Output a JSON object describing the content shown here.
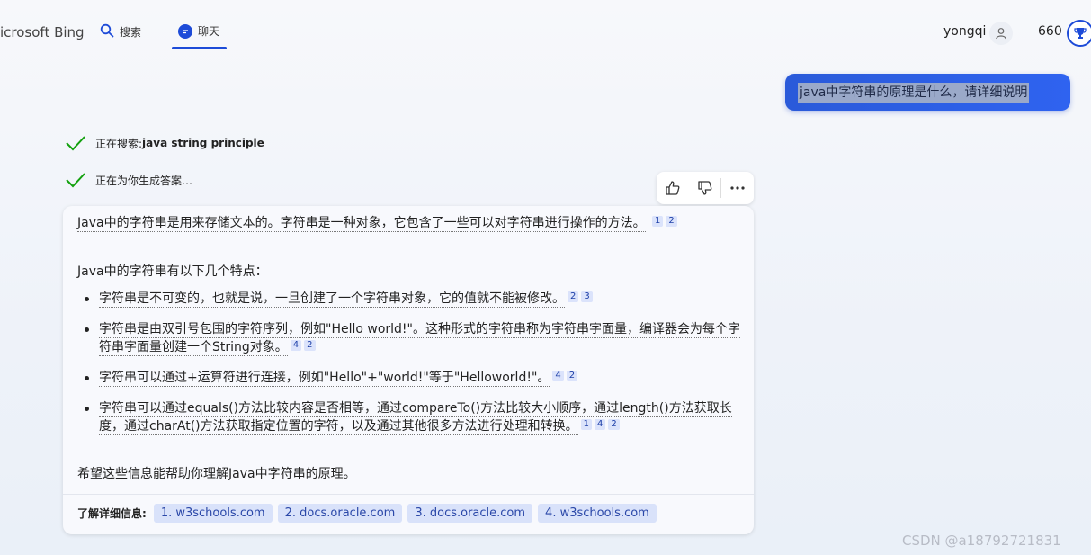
{
  "header": {
    "brand": "icrosoft Bing",
    "tabs": [
      {
        "label": "搜索",
        "icon": "search-icon"
      },
      {
        "label": "聊天",
        "icon": "chat-icon"
      }
    ],
    "user_name": "yongqi",
    "points": "660",
    "accent_color": "#1d4bd8"
  },
  "user_message": "java中字符串的原理是什么，请详细说明",
  "progress": [
    {
      "prefix": "正在搜索: ",
      "query": "java string principle"
    },
    {
      "prefix": "正在为你生成答案…",
      "query": ""
    }
  ],
  "answer": {
    "intro": "Java中的字符串是用来存储文本的。字符串是一种对象，它包含了一些可以对字符串进行操作的方法。",
    "intro_refs": [
      "1",
      "2"
    ],
    "features_heading": "Java中的字符串有以下几个特点：",
    "bullets": [
      {
        "text": "字符串是不可变的，也就是说，一旦创建了一个字符串对象，它的值就不能被修改。",
        "refs": [
          "2",
          "3"
        ]
      },
      {
        "text": "字符串是由双引号包围的字符序列，例如\"Hello world!\"。这种形式的字符串称为字符串字面量，编译器会为每个字符串字面量创建一个String对象。",
        "refs": [
          "4",
          "2"
        ]
      },
      {
        "text": "字符串可以通过+运算符进行连接，例如\"Hello\"+\"world!\"等于\"Helloworld!\"。",
        "refs": [
          "4",
          "2"
        ]
      },
      {
        "text": "字符串可以通过equals()方法比较内容是否相等，通过compareTo()方法比较大小顺序，通过length()方法获取长度，通过charAt()方法获取指定位置的字符，以及通过其他很多方法进行处理和转换。",
        "refs": [
          "1",
          "4",
          "2"
        ]
      }
    ],
    "closing": "希望这些信息能帮助你理解Java中字符串的原理。",
    "learn_more_label": "了解详细信息:",
    "sources": [
      "1. w3schools.com",
      "2. docs.oracle.com",
      "3. docs.oracle.com",
      "4. w3schools.com"
    ]
  },
  "watermark": "CSDN @a18792721831"
}
